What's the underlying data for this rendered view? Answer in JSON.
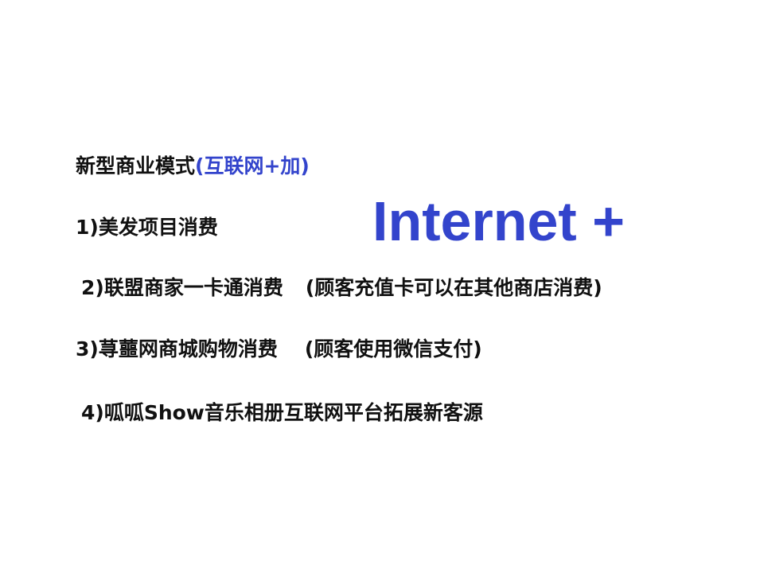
{
  "slide": {
    "heading": {
      "text": "新型商业模式",
      "highlight": "(互联网+加)"
    },
    "banner": "Internet +",
    "items": [
      {
        "text": "1)美发项目消费",
        "note": ""
      },
      {
        "text": "2)联盟商家一卡通消费",
        "note": "(顾客充值卡可以在其他商店消费)"
      },
      {
        "text": "3)荨蘁网商城购物消费",
        "note": "(顾客使用微信支付)"
      },
      {
        "text": "4)呱呱Show音乐相册互联网平台拓展新客源",
        "note": ""
      }
    ]
  },
  "colors": {
    "text": "#111111",
    "accent": "#3344cc",
    "background": "#ffffff"
  }
}
